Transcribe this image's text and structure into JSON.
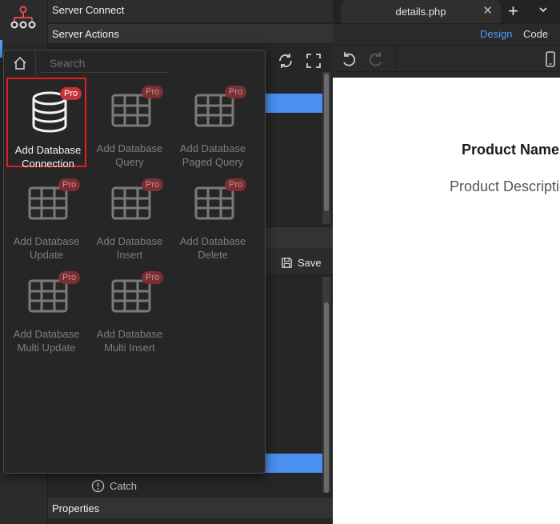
{
  "panel": {
    "title": "Server Connect",
    "actions_header": "Server Actions",
    "properties_header": "Properties",
    "save_label": "Save",
    "catch_label": "Catch"
  },
  "editor": {
    "tab_label": "details.php",
    "design_label": "Design",
    "code_label": "Code",
    "product_name": "Product Name",
    "product_description": "Product Description"
  },
  "popup": {
    "search_placeholder": "Search",
    "pro_badge": "Pro",
    "tiles": [
      {
        "line1": "Add Database",
        "line2": "Connection",
        "icon": "database-icon"
      },
      {
        "line1": "Add Database",
        "line2": "Query",
        "icon": "table-icon"
      },
      {
        "line1": "Add Database",
        "line2": "Paged Query",
        "icon": "table-icon"
      },
      {
        "line1": "Add Database",
        "line2": "Update",
        "icon": "table-icon"
      },
      {
        "line1": "Add Database",
        "line2": "Insert",
        "icon": "table-icon"
      },
      {
        "line1": "Add Database",
        "line2": "Delete",
        "icon": "table-icon"
      },
      {
        "line1": "Add Database",
        "line2": "Multi Update",
        "icon": "table-icon"
      },
      {
        "line1": "Add Database",
        "line2": "Multi Insert",
        "icon": "table-icon"
      }
    ]
  },
  "colors": {
    "accent": "#4d9cf5",
    "selection": "#4a90f0",
    "highlight_border": "#e02020",
    "pro_badge": "#c4323a"
  }
}
